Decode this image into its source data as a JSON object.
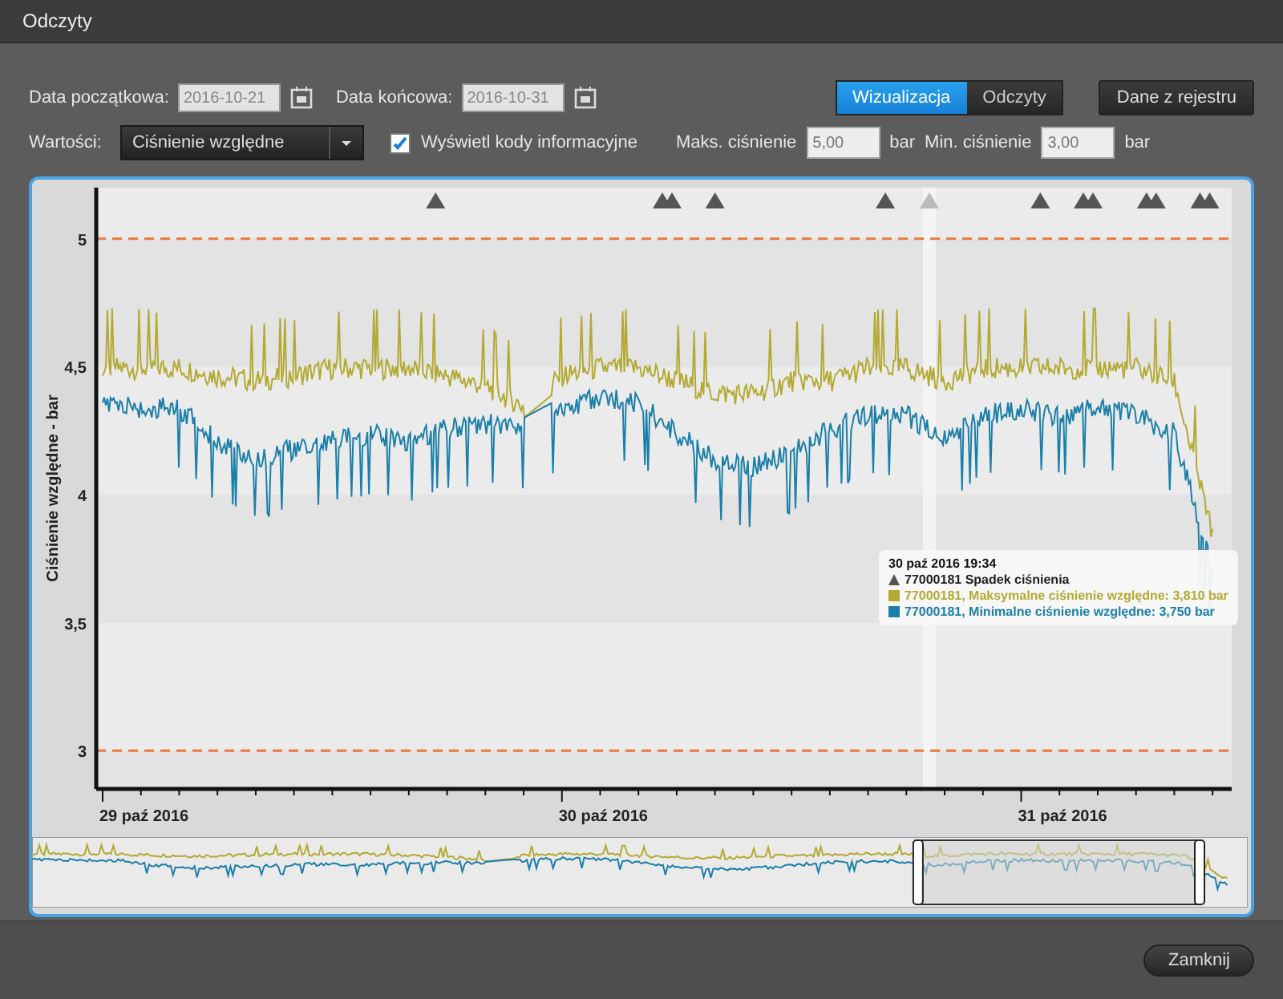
{
  "window": {
    "title": "Odczyty"
  },
  "filters": {
    "start_label": "Data początkowa:",
    "start_value": "2016-10-21",
    "end_label": "Data końcowa:",
    "end_value": "2016-10-31",
    "values_label": "Wartości:",
    "values_select": "Ciśnienie względne",
    "show_codes": {
      "label": "Wyświetl kody informacyjne",
      "checked": true
    },
    "max_label": "Maks. ciśnienie",
    "max_value": "5,00",
    "max_unit": "bar",
    "min_label": "Min. ciśnienie",
    "min_value": "3,00",
    "min_unit": "bar"
  },
  "view_tabs": [
    {
      "label": "Wizualizacja",
      "selected": true
    },
    {
      "label": "Odczyty",
      "selected": false
    }
  ],
  "registry_button": "Dane z rejestru",
  "chart": {
    "y_axis_title": "Ciśnienie względne - bar",
    "y_ticks": [
      "5",
      "4,5",
      "4",
      "3,5",
      "3"
    ],
    "x_ticks": [
      "29 paź 2016",
      "30 paź 2016",
      "31 paź 2016"
    ],
    "series": [
      {
        "color": "#b3aa33"
      },
      {
        "color": "#1b7fa8"
      }
    ],
    "tooltip": {
      "title": "30 paź 2016 19:34",
      "lines": [
        {
          "kind": "event",
          "text": "77000181 Spadek ciśnienia"
        },
        {
          "kind": "series",
          "color": "#b3aa33",
          "text": "77000181, Maksymalne ciśnienie względne: 3,810 bar"
        },
        {
          "kind": "series",
          "color": "#1b7fa8",
          "text": "77000181, Minimalne ciśnienie względne: 3,750 bar"
        }
      ]
    }
  },
  "close_button": "Zamknij"
}
